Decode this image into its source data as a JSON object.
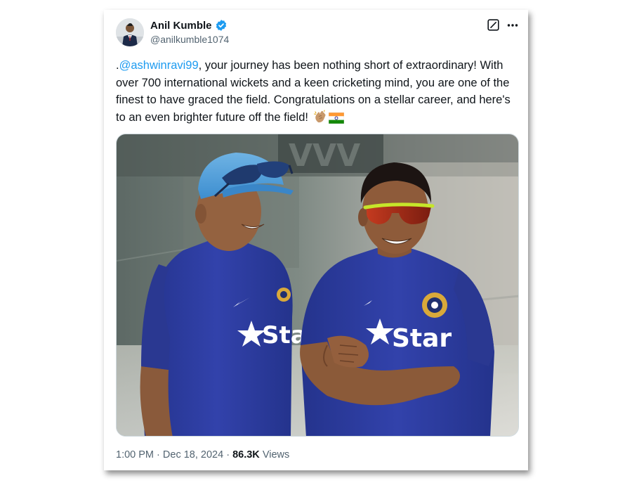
{
  "author": {
    "name": "Anil Kumble",
    "handle": "@anilkumble1074",
    "verified": true,
    "verified_color": "#1d9bf0"
  },
  "tweet": {
    "prefix": ".",
    "mention": "@ashwinravi99",
    "body": ", your journey has been nothing short of extraordinary! With over 700 international wickets and a keen cricketing mind, you are one of the finest to have graced the field. Congratulations on a stellar career, and here's to an even brighter future off the field!",
    "emojis": [
      "clapping-hands-emoji",
      "india-flag-emoji"
    ]
  },
  "media": {
    "shirt_text_left": "Star",
    "shirt_text_right": "Star"
  },
  "meta": {
    "time": "1:00 PM",
    "separator": "·",
    "date": "Dec 18, 2024",
    "views_count": "86.3K",
    "views_label": "Views"
  },
  "icons": [
    "grok-icon",
    "more-icon",
    "verified-badge-icon"
  ],
  "colors": {
    "link": "#1d9bf0",
    "secondary_text": "#536471",
    "primary_text": "#0f1419",
    "jersey": "#2b3a9e"
  }
}
